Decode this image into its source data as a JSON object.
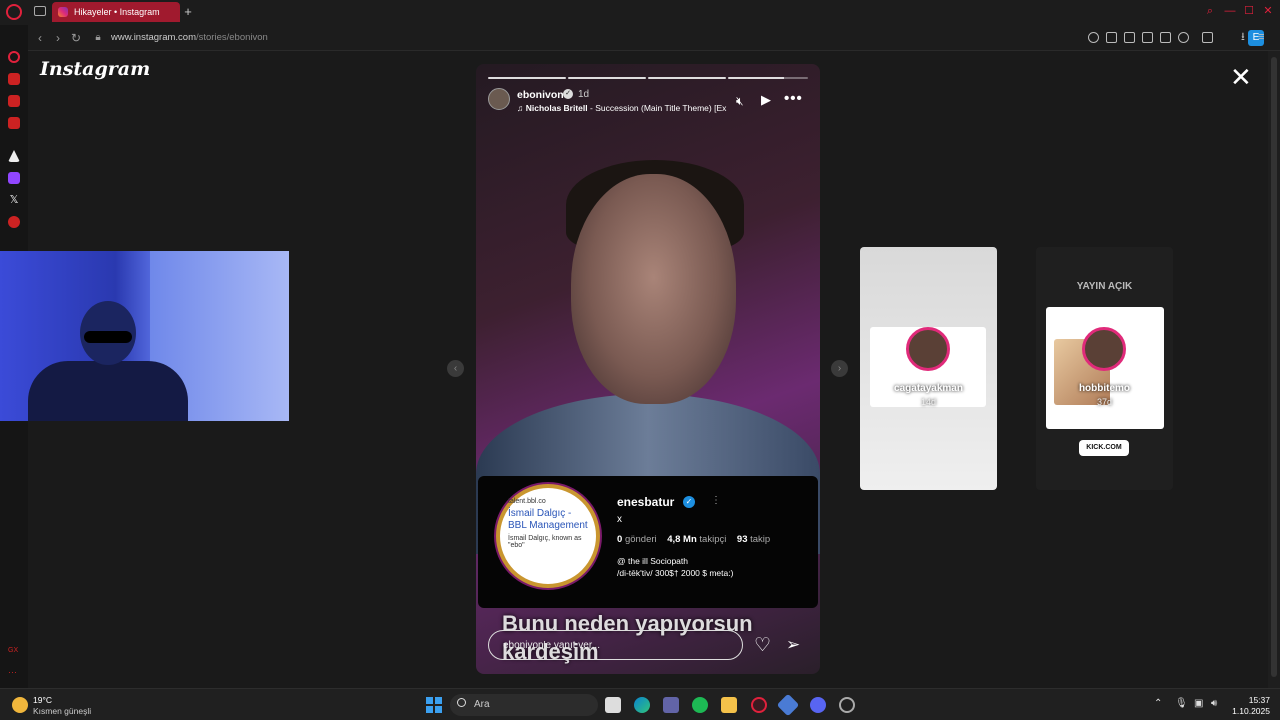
{
  "browser": {
    "tab_title": "Hikayeler • Instagram",
    "new_tab": "+",
    "url_host": "www.instagram.com",
    "url_path": "/stories/ebonivon",
    "extension_letter": "E",
    "accent_color": "#e0213c"
  },
  "page": {
    "logo": "Instagram",
    "close": "✕"
  },
  "story": {
    "username": "ebonivon",
    "time": "1d",
    "music_artist": "Nicholas Britell",
    "music_title": " - Succession (Main Title Theme) [Ex",
    "caption_line1": "Bunu neden yapıyorsun",
    "caption_line2": "kardeşim",
    "reply_placeholder": "ebonivon'e yanıt ver...",
    "progress_segments": 4,
    "profile_card": {
      "name": "enesbatur",
      "bio_short": "x",
      "posts_count": "0",
      "posts_label": "gönderi",
      "followers_count": "4,8 Mn",
      "followers_label": "takipçi",
      "following_count": "93",
      "following_label": "takip",
      "bio_line1": "@ the ill Sociopath",
      "bio_line2": "/di-tēk'tiv/ 300$† 2000 $ meta:)",
      "avatar_site": "talent.bbl.co",
      "avatar_title": "İsmail Dalgıç - BBL Management",
      "avatar_text": "İsmail Dalgıç, known as \"ebo\""
    }
  },
  "previews": [
    {
      "username": "cagatayakman",
      "time": "14d"
    },
    {
      "username": "hobbitemo",
      "time": "37d",
      "banner": "YAYIN AÇIK",
      "badge": "KICK.COM"
    }
  ],
  "taskbar": {
    "temperature": "19°C",
    "weather": "Kısmen güneşli",
    "search_placeholder": "Ara",
    "time": "15:37",
    "date": "1.10.2025"
  }
}
